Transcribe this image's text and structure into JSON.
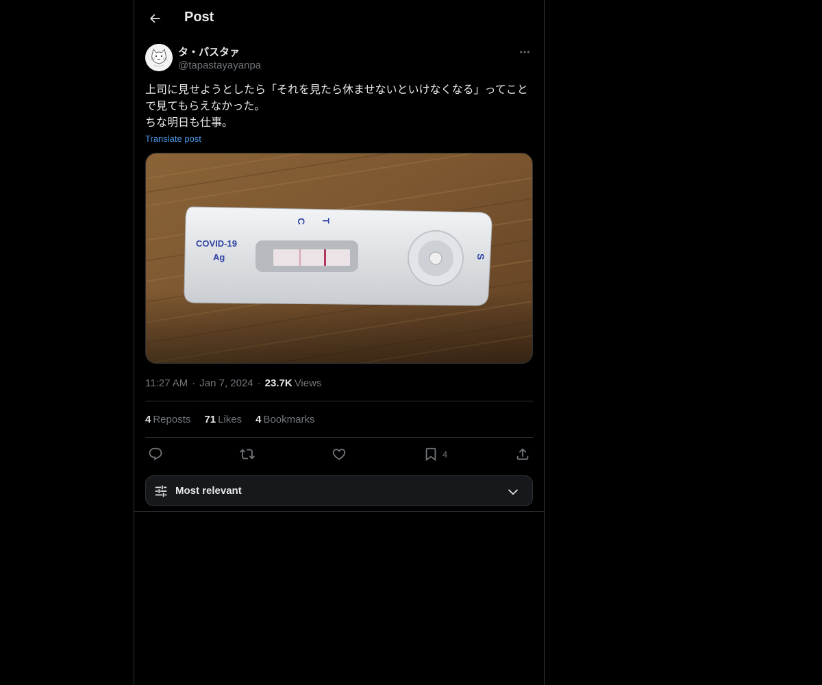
{
  "header": {
    "title": "Post",
    "back_icon": "arrow-left-icon"
  },
  "post": {
    "author": {
      "display_name": "タ・パスタァ",
      "handle": "@tapastayayanpa",
      "avatar_icon": "cat-avatar-icon"
    },
    "text": "上司に見せようとしたら「それを見たら休ませないといけなくなる」ってことで見てもらえなかった。\nちな明日も仕事。",
    "translate_label": "Translate post",
    "media": {
      "device_label_line1": "COVID-19",
      "device_label_line2": "Ag",
      "marker_c": "C",
      "marker_t": "T",
      "marker_s": "S"
    },
    "meta": {
      "time": "11:27 AM",
      "separator": "·",
      "date": "Jan 7, 2024",
      "views_count": "23.7K",
      "views_label": "Views"
    },
    "stats": {
      "reposts_count": "4",
      "reposts_label": "Reposts",
      "likes_count": "71",
      "likes_label": "Likes",
      "bookmarks_count": "4",
      "bookmarks_label": "Bookmarks"
    },
    "actions": {
      "bookmark_count": "4"
    }
  },
  "replies": {
    "sort_label": "Most relevant"
  },
  "colors": {
    "background": "#000000",
    "text": "#e7e9ea",
    "muted": "#71767b",
    "link": "#4a99e9",
    "border": "#2f3336"
  }
}
